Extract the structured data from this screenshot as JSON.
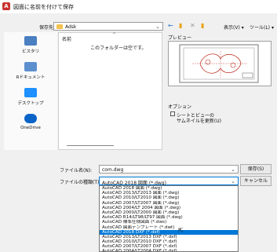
{
  "window": {
    "title": "図面に名前を付けて保存"
  },
  "save_in": {
    "label": "保存先(I):",
    "value": "Adsk"
  },
  "toolbar": {
    "back_icon": "back-arrow-icon",
    "up_icon": "folder-up-icon",
    "delete_icon": "delete-icon",
    "new_folder_icon": "new-folder-icon",
    "views_label": "表示(V)",
    "tools_label": "ツール(L)"
  },
  "places": [
    {
      "label": "ビスタリ",
      "icon": "library-icon",
      "color": "#4a7fc1"
    },
    {
      "label": "Rドキュメント",
      "icon": "documents-icon",
      "color": "#5b8fce"
    },
    {
      "label": "デスクトップ",
      "icon": "desktop-icon",
      "color": "#1e90ff"
    },
    {
      "label": "OneDrive",
      "icon": "onedrive-icon",
      "color": "#0a64c8"
    }
  ],
  "filelist": {
    "column_name": "名前",
    "empty_message": "このフォルダーは空です。"
  },
  "preview": {
    "label": "プレビュー"
  },
  "options": {
    "label": "オプション",
    "checkbox_label_line1": "シートとビューの",
    "checkbox_label_line2": "サムネイルを更新(U)"
  },
  "filename": {
    "label": "ファイル名(N):",
    "value": "com.dwg"
  },
  "filetype": {
    "label": "ファイルの種類(T):",
    "value": "AutoCAD 2018 図面 (*.dwg)",
    "options": [
      "AutoCAD 2018 図面 (*.dwg)",
      "AutoCAD 2013/LT2013 図面 (*.dwg)",
      "AutoCAD 2010/LT2010 図面 (*.dwg)",
      "AutoCAD 2007/LT2007 図面 (*.dwg)",
      "AutoCAD 2004/LT 2004 図面 (*.dwg)",
      "AutoCAD 2000/LT2000 図面 (*.dwg)",
      "AutoCAD R14/LT98/LT97 図面 (*.dwg)",
      "AutoCAD 標準仕様図面 (*.dws)",
      "AutoCAD 図面テンプレート (*.dwt)",
      "AutoCAD 2018 DXF (*.dxf)",
      "AutoCAD 2013/LT2013 DXF (*.dxf)",
      "AutoCAD 2010/LT2010 DXF (*.dxf)",
      "AutoCAD 2007/LT2007 DXF (*.dxf)",
      "AutoCAD 2004/LT2004 DXF (*.dxf)",
      "AutoCAD 2000/LT2000 DXF (*.dxf)",
      "AutoCAD R12/LT2 DXF (*.dxf)"
    ],
    "selected_index": 9
  },
  "buttons": {
    "save": "保存(S)",
    "cancel": "キャンセル"
  },
  "colors": {
    "accent": "#0078d7",
    "titlebar": "#ffffff",
    "dialog": "#f0f0f0"
  }
}
